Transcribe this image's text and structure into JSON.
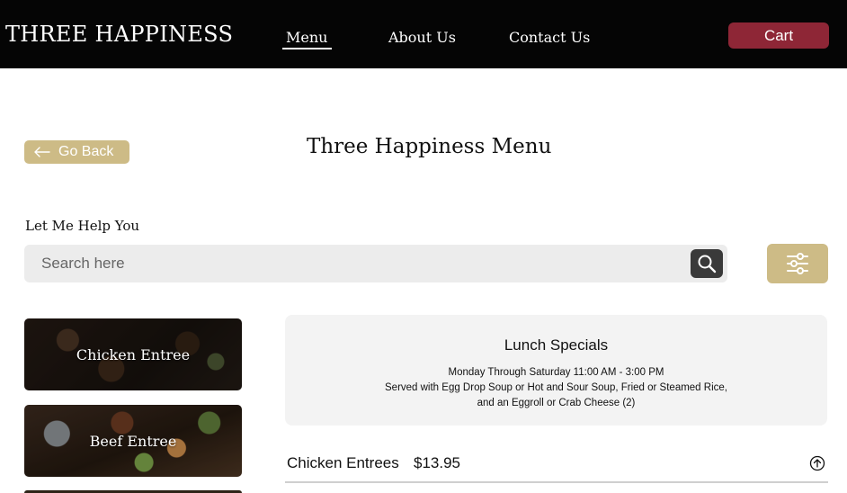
{
  "header": {
    "brand": "THREE HAPPINESS",
    "nav": [
      {
        "label": "Menu",
        "active": true
      },
      {
        "label": "About Us",
        "active": false
      },
      {
        "label": "Contact Us",
        "active": false
      }
    ],
    "cart_label": "Cart"
  },
  "colors": {
    "header_bg": "#050505",
    "cart_button": "#8e2636",
    "accent_gold": "#cdbb86",
    "search_bg": "#ececec",
    "panel_bg": "#f3f3f3"
  },
  "page": {
    "go_back_label": "Go Back",
    "title": "Three Happiness Menu"
  },
  "search": {
    "label": "Let Me Help You",
    "placeholder": "Search here",
    "value": "",
    "icons": {
      "search": "search-icon",
      "filter": "sliders-icon"
    }
  },
  "categories": [
    {
      "label": "Chicken Entree"
    },
    {
      "label": "Beef Entree"
    }
  ],
  "specials": {
    "title": "Lunch Specials",
    "lines": [
      "Monday Through Saturday 11:00 AM - 3:00 PM",
      "Served with Egg Drop Soup or Hot and Sour Soup, Fried or Steamed Rice,",
      "and an Eggroll or Crab Cheese (2)"
    ]
  },
  "entrees": [
    {
      "name": "Chicken Entrees",
      "price": "$13.95",
      "icon": "arrow-up-circle-icon"
    }
  ]
}
